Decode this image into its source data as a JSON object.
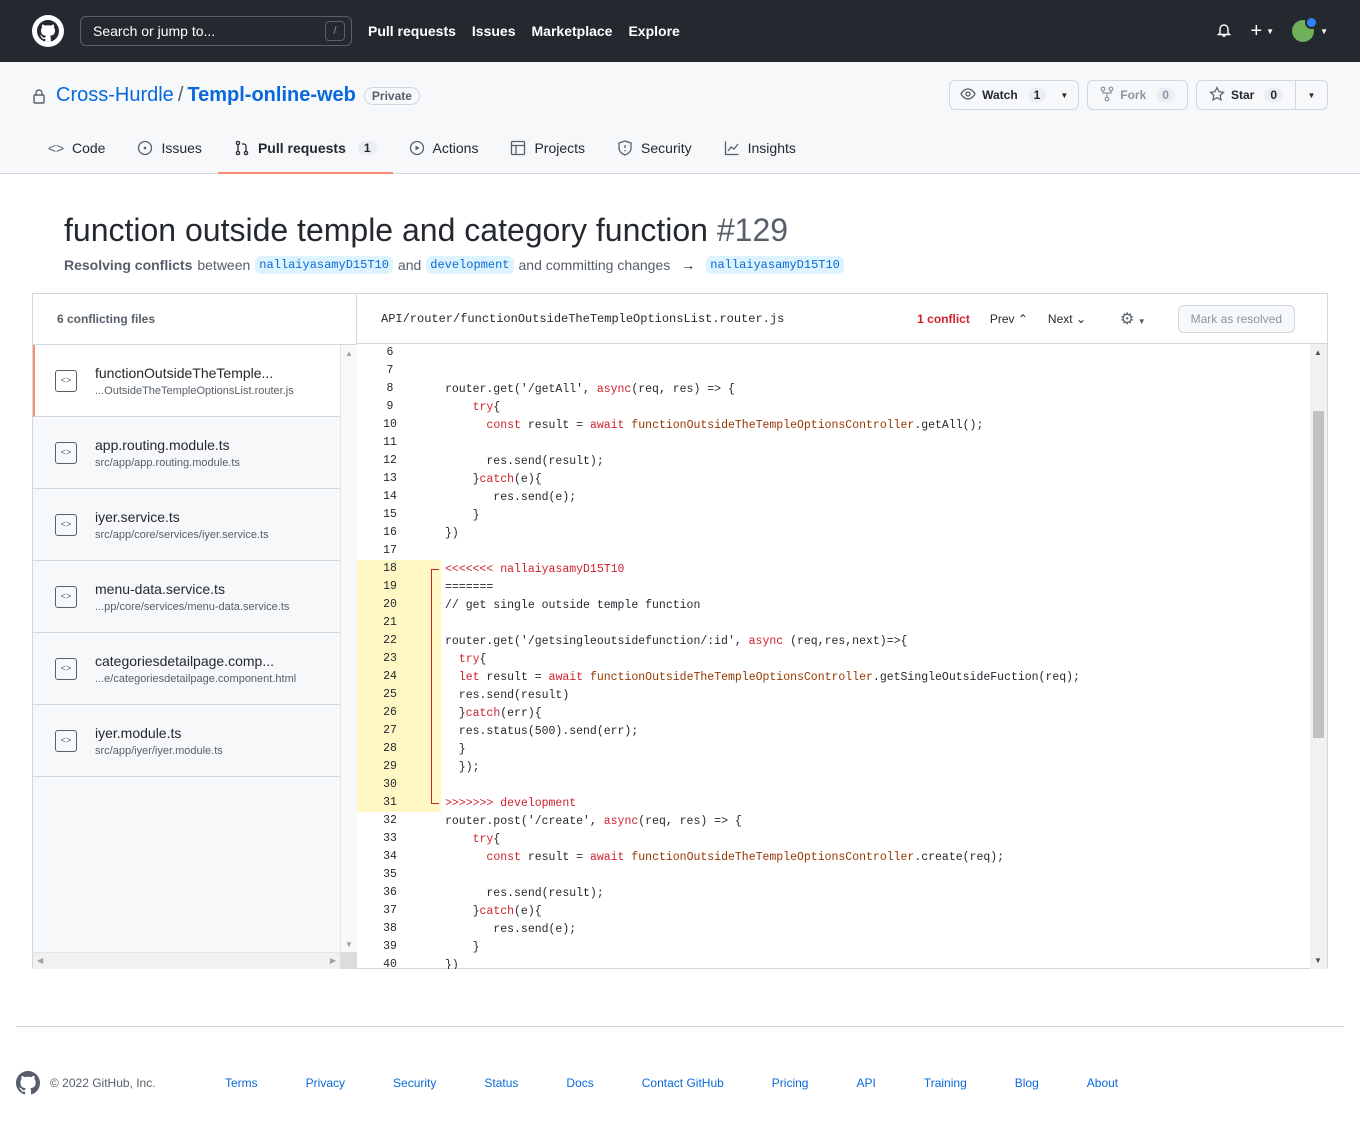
{
  "topbar": {
    "search_placeholder": "Search or jump to...",
    "search_key": "/",
    "nav": [
      "Pull requests",
      "Issues",
      "Marketplace",
      "Explore"
    ]
  },
  "repo": {
    "owner": "Cross-Hurdle",
    "separator": "/",
    "name": "Templ-online-web",
    "visibility": "Private",
    "watch_label": "Watch",
    "watch_count": "1",
    "fork_label": "Fork",
    "fork_count": "0",
    "star_label": "Star",
    "star_count": "0"
  },
  "tabs": [
    {
      "label": "Code",
      "icon": "code-icon"
    },
    {
      "label": "Issues",
      "icon": "issue-icon"
    },
    {
      "label": "Pull requests",
      "icon": "pull-request-icon",
      "count": "1",
      "active": true
    },
    {
      "label": "Actions",
      "icon": "play-icon"
    },
    {
      "label": "Projects",
      "icon": "table-icon"
    },
    {
      "label": "Security",
      "icon": "shield-icon"
    },
    {
      "label": "Insights",
      "icon": "graph-icon"
    }
  ],
  "pr": {
    "title": "function outside temple and category function",
    "number": "#129",
    "resolving": "Resolving conflicts",
    "between": "between",
    "head_branch": "nallaiyasamyD15T10",
    "and": "and",
    "base_branch": "development",
    "committing": "and committing changes",
    "target_branch": "nallaiyasamyD15T10"
  },
  "sidebar": {
    "header": "6 conflicting files",
    "files": [
      {
        "name": "functionOutsideTheTemple...",
        "path": "...OutsideTheTempleOptionsList.router.js"
      },
      {
        "name": "app.routing.module.ts",
        "path": "src/app/app.routing.module.ts"
      },
      {
        "name": "iyer.service.ts",
        "path": "src/app/core/services/iyer.service.ts"
      },
      {
        "name": "menu-data.service.ts",
        "path": "...pp/core/services/menu-data.service.ts"
      },
      {
        "name": "categoriesdetailpage.comp...",
        "path": "...e/categoriesdetailpage.component.html"
      },
      {
        "name": "iyer.module.ts",
        "path": "src/app/iyer/iyer.module.ts"
      }
    ]
  },
  "editor": {
    "file_path": "API/router/functionOutsideTheTempleOptionsList.router.js",
    "conflict_count": "1 conflict",
    "prev": "Prev",
    "next": "Next",
    "resolve_label": "Mark as resolved"
  },
  "code_lines": [
    {
      "n": "6",
      "t": ""
    },
    {
      "n": "7",
      "t": ""
    },
    {
      "n": "8",
      "t": "router.get('/getAll', async(req, res) => {"
    },
    {
      "n": "9",
      "t": "    try{"
    },
    {
      "n": "10",
      "t": "      const result = await functionOutsideTheTempleOptionsController.getAll();"
    },
    {
      "n": "11",
      "t": ""
    },
    {
      "n": "12",
      "t": "      res.send(result);"
    },
    {
      "n": "13",
      "t": "    }catch(e){"
    },
    {
      "n": "14",
      "t": "       res.send(e);"
    },
    {
      "n": "15",
      "t": "    }"
    },
    {
      "n": "16",
      "t": "})"
    },
    {
      "n": "17",
      "t": ""
    },
    {
      "n": "18",
      "t": "<<<<<<< nallaiyasamyD15T10",
      "c": "top"
    },
    {
      "n": "19",
      "t": "=======",
      "c": "mid"
    },
    {
      "n": "20",
      "t": "// get single outside temple function",
      "c": "mid"
    },
    {
      "n": "21",
      "t": "",
      "c": "mid"
    },
    {
      "n": "22",
      "t": "router.get('/getsingleoutsidefunction/:id', async (req,res,next)=>{",
      "c": "mid"
    },
    {
      "n": "23",
      "t": "  try{",
      "c": "mid"
    },
    {
      "n": "24",
      "t": "  let result = await functionOutsideTheTempleOptionsController.getSingleOutsideFuction(req);",
      "c": "mid"
    },
    {
      "n": "25",
      "t": "  res.send(result)",
      "c": "mid"
    },
    {
      "n": "26",
      "t": "  }catch(err){",
      "c": "mid"
    },
    {
      "n": "27",
      "t": "  res.status(500).send(err);",
      "c": "mid"
    },
    {
      "n": "28",
      "t": "  }",
      "c": "mid"
    },
    {
      "n": "29",
      "t": "  });",
      "c": "mid"
    },
    {
      "n": "30",
      "t": "",
      "c": "mid"
    },
    {
      "n": "31",
      "t": ">>>>>>> development",
      "c": "bot"
    },
    {
      "n": "32",
      "t": "router.post('/create', async(req, res) => {"
    },
    {
      "n": "33",
      "t": "    try{"
    },
    {
      "n": "34",
      "t": "      const result = await functionOutsideTheTempleOptionsController.create(req);"
    },
    {
      "n": "35",
      "t": ""
    },
    {
      "n": "36",
      "t": "      res.send(result);"
    },
    {
      "n": "37",
      "t": "    }catch(e){"
    },
    {
      "n": "38",
      "t": "       res.send(e);"
    },
    {
      "n": "39",
      "t": "    }"
    },
    {
      "n": "40",
      "t": "})"
    }
  ],
  "footer": {
    "copyright": "© 2022 GitHub, Inc.",
    "links": [
      "Terms",
      "Privacy",
      "Security",
      "Status",
      "Docs",
      "Contact GitHub",
      "Pricing",
      "API",
      "Training",
      "Blog",
      "About"
    ]
  }
}
